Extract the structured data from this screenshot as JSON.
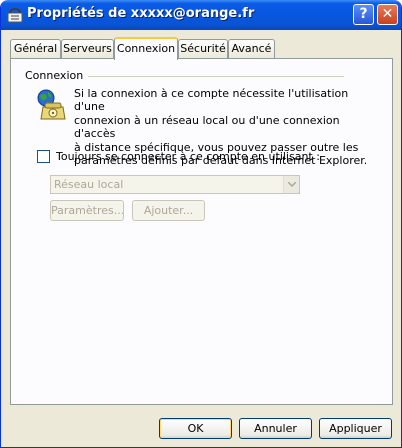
{
  "window": {
    "title": "Propriétés de xxxxx@orange.fr"
  },
  "titlebar_buttons": {
    "help": "?",
    "close": "✕"
  },
  "tabs": [
    {
      "label": "Général"
    },
    {
      "label": "Serveurs"
    },
    {
      "label": "Connexion"
    },
    {
      "label": "Sécurité"
    },
    {
      "label": "Avancé"
    }
  ],
  "active_tab": "Connexion",
  "connexion": {
    "group_label": "Connexion",
    "info_lines": [
      "Si la connexion à ce compte nécessite l'utilisation d'une",
      "connexion à un réseau local ou d'une connexion d'accès",
      "à distance spécifique, vous pouvez passer outre les",
      "paramètres définis par défaut dans Internet Explorer."
    ],
    "checkbox_label": "Toujours se connecter à ce compte en utilisant :",
    "checkbox_checked": false,
    "select_value": "Réseau local",
    "settings_button": "Paramètres...",
    "add_button": "Ajouter..."
  },
  "footer": {
    "ok": "OK",
    "cancel": "Annuler",
    "apply": "Appliquer"
  }
}
